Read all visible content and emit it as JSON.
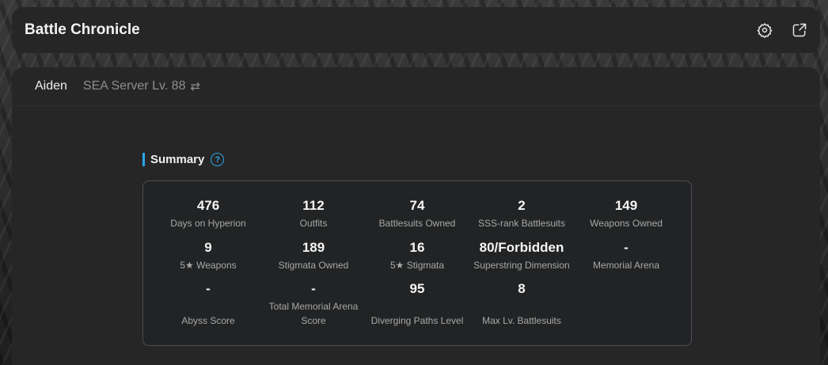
{
  "header": {
    "title": "Battle Chronicle",
    "settings_icon": "gear-icon",
    "share_icon": "external-link-icon"
  },
  "account": {
    "nickname": "Aiden",
    "server": "SEA Server Lv. 88",
    "switch_symbol": "⇄"
  },
  "summary": {
    "title": "Summary",
    "help_symbol": "?",
    "accent_color": "#2aa5e8",
    "stats": [
      {
        "value": "476",
        "label": "Days on Hyperion"
      },
      {
        "value": "112",
        "label": "Outfits"
      },
      {
        "value": "74",
        "label": "Battlesuits Owned"
      },
      {
        "value": "2",
        "label": "SSS-rank Battlesuits"
      },
      {
        "value": "149",
        "label": "Weapons Owned"
      },
      {
        "value": "9",
        "label": "5★ Weapons"
      },
      {
        "value": "189",
        "label": "Stigmata Owned"
      },
      {
        "value": "16",
        "label": "5★ Stigmata"
      },
      {
        "value": "80/Forbidden",
        "label": "Superstring Dimension"
      },
      {
        "value": "-",
        "label": "Memorial Arena"
      },
      {
        "value": "-",
        "label": "Abyss Score"
      },
      {
        "value": "-",
        "label": "Total Memorial Arena Score"
      },
      {
        "value": "95",
        "label": "Diverging Paths Level"
      },
      {
        "value": "8",
        "label": "Max Lv. Battlesuits"
      }
    ]
  }
}
